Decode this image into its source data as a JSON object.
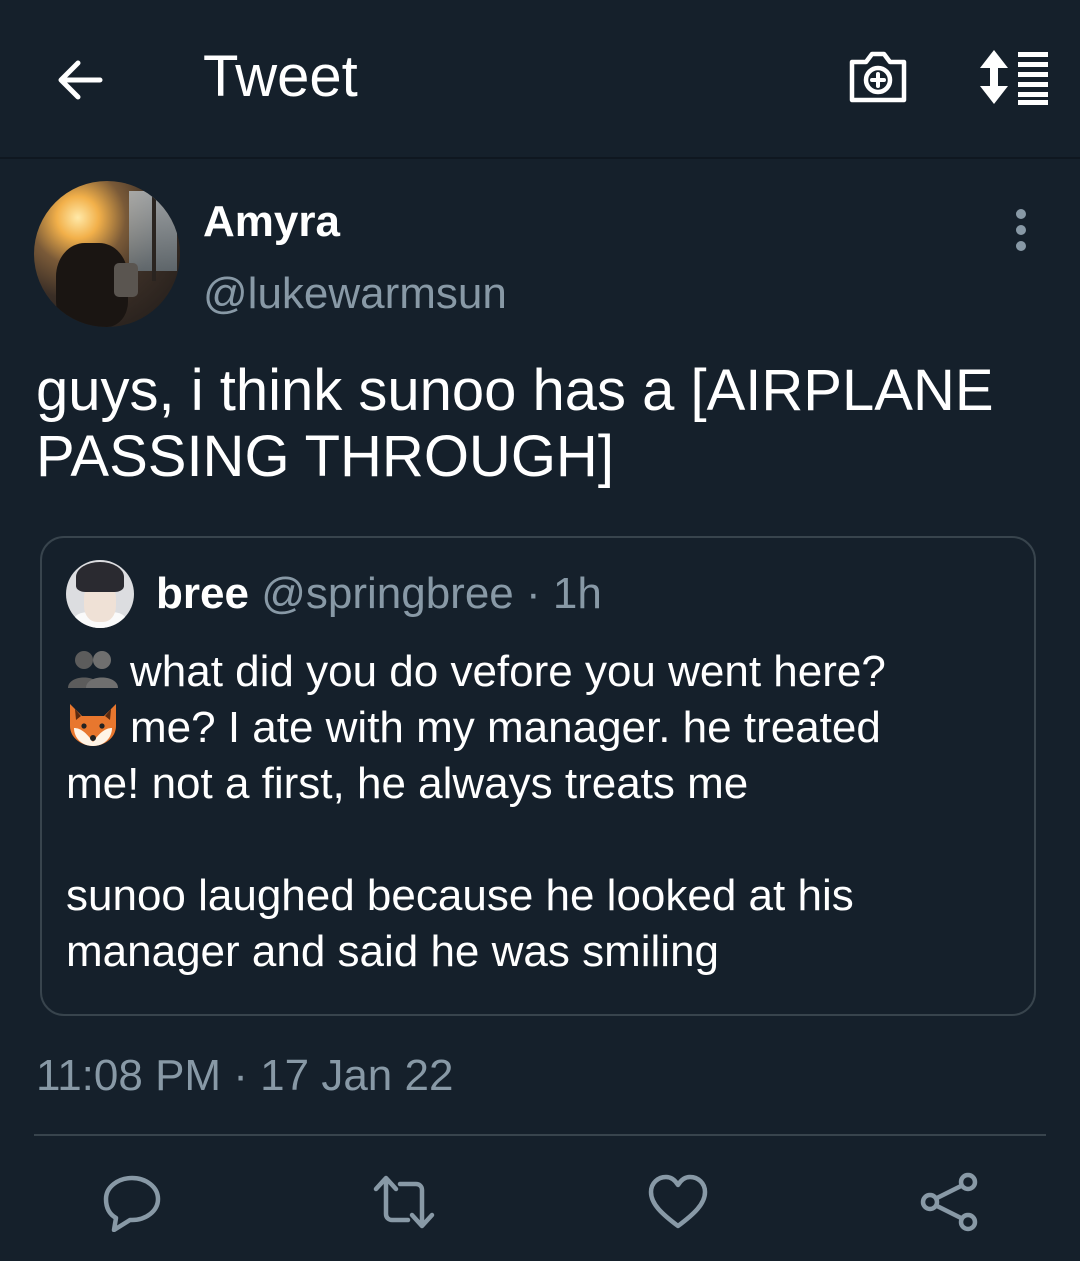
{
  "header": {
    "title": "Tweet"
  },
  "tweet": {
    "author_name": "Amyra",
    "author_handle": "@lukewarmsun",
    "text_line1": "guys, i think sunoo has a [AIRPLANE",
    "text_line2": "PASSING THROUGH]",
    "timestamp": "11:08 PM · 17 Jan 22"
  },
  "quoted": {
    "name": "bree",
    "meta": "@springbree · 1h",
    "line1": "what did you do vefore you went here?",
    "line2": "me? I ate with my manager. he treated",
    "line3": "me! not a first, he always treats me",
    "line4": "sunoo laughed because he looked at his",
    "line5": "manager and said he was smiling"
  },
  "icons": {
    "back": "arrow-left-icon",
    "camera": "camera-plus-icon",
    "sort": "sort-list-icon",
    "more": "more-vertical-icon",
    "reply": "reply-icon",
    "retweet": "retweet-icon",
    "like": "heart-icon",
    "share": "share-icon",
    "people_emoji": "two-people-emoji",
    "fox_emoji": "fox-emoji"
  },
  "colors": {
    "background": "#15202b",
    "secondary_text": "#8899a6",
    "border": "#38444d"
  }
}
